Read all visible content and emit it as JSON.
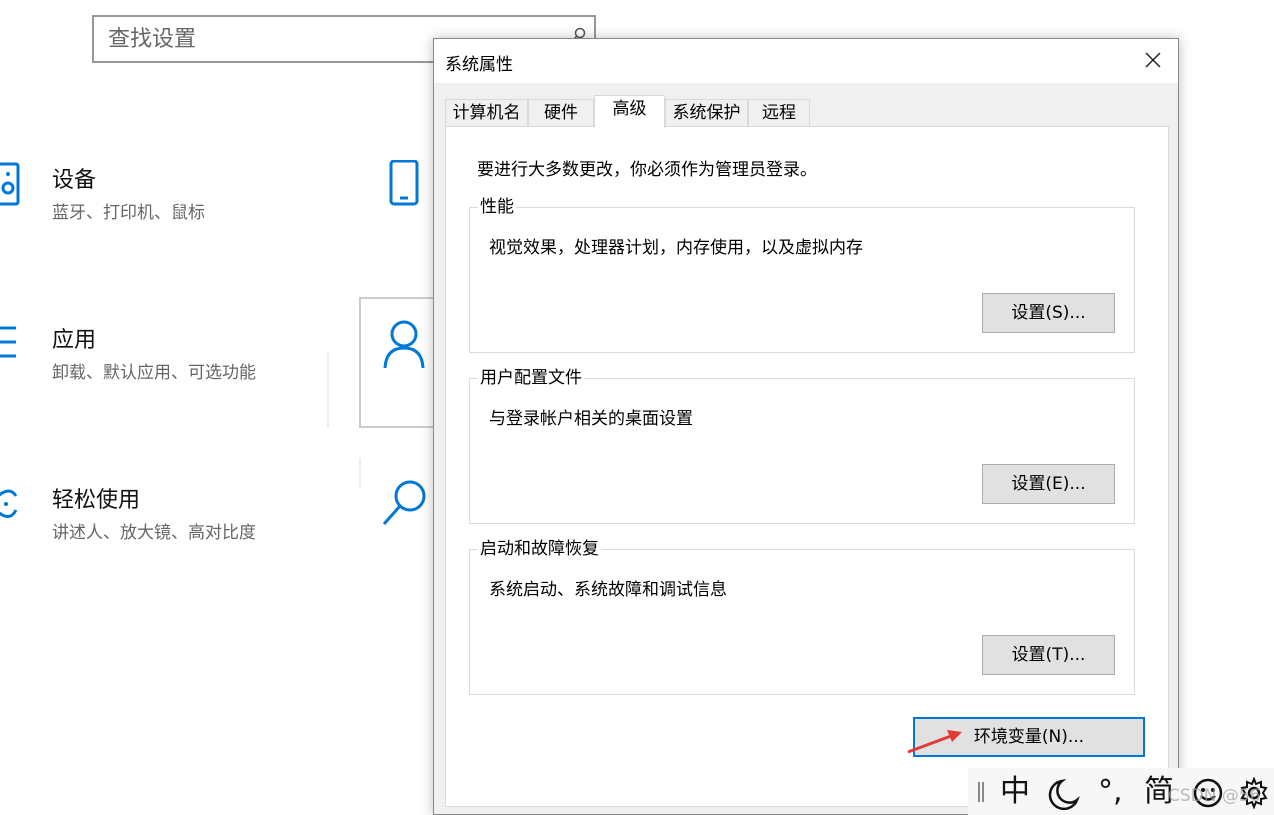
{
  "search": {
    "placeholder": "查找设置"
  },
  "categories": [
    {
      "title": "设备",
      "subtitle": "蓝牙、打印机、鼠标",
      "icon": "keyboard-speaker-icon"
    },
    {
      "title": "应用",
      "subtitle": "卸载、默认应用、可选功能",
      "icon": "app-list-icon"
    },
    {
      "title": "轻松使用",
      "subtitle": "讲述人、放大镜、高对比度",
      "icon": "ease-of-access-icon"
    }
  ],
  "right_icons": [
    "phone-icon",
    "person-icon",
    "search-icon"
  ],
  "accent_color": "#0078d7",
  "dialog": {
    "title": "系统属性",
    "tabs": [
      {
        "label": "计算机名"
      },
      {
        "label": "硬件"
      },
      {
        "label": "高级"
      },
      {
        "label": "系统保护"
      },
      {
        "label": "远程"
      }
    ],
    "active_tab": "高级",
    "notice": "要进行大多数更改，你必须作为管理员登录。",
    "groups": [
      {
        "legend": "性能",
        "description": "视觉效果，处理器计划，内存使用，以及虚拟内存",
        "button": "设置(S)..."
      },
      {
        "legend": "用户配置文件",
        "description": "与登录帐户相关的桌面设置",
        "button": "设置(E)..."
      },
      {
        "legend": "启动和故障恢复",
        "description": "系统启动、系统故障和调试信息",
        "button": "设置(T)..."
      }
    ],
    "env_button": "环境变量(N)..."
  },
  "ime": {
    "mode": "中",
    "punct": "°,",
    "script": "简"
  },
  "watermark": "CSDN @56"
}
